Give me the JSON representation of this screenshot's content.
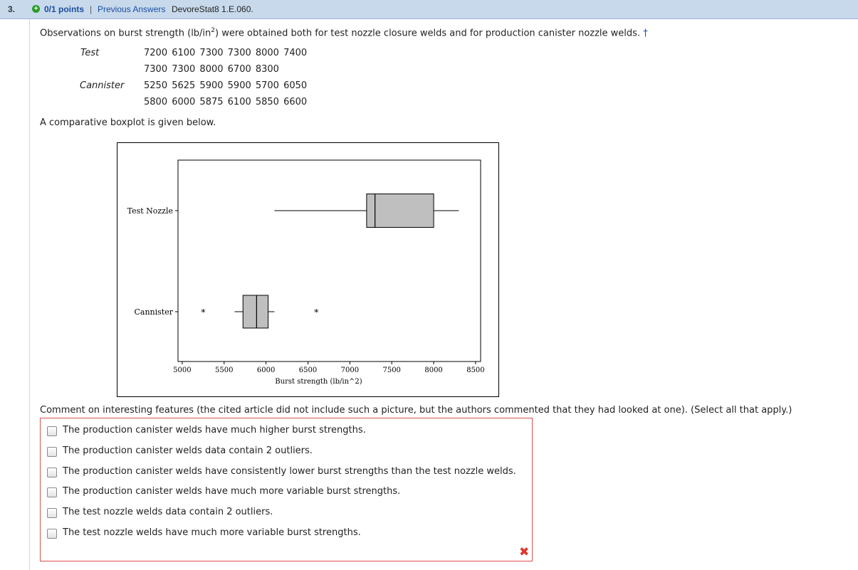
{
  "header": {
    "question_number": "3.",
    "plus_icon": "+",
    "points": "0/1 points",
    "separator": "|",
    "previous_answers": "Previous Answers",
    "code": "DevoreStat8 1.E.060."
  },
  "intro": {
    "before": "Observations on burst strength (lb/in",
    "sup": "2",
    "after": ") were obtained both for test nozzle closure welds and for production canister nozzle welds.",
    "dagger": "†"
  },
  "data_table": {
    "test_label": "Test",
    "test_row1": "7200 6100 7300 7300 8000 7400",
    "test_row2": "7300 7300 8000 6700 8300",
    "cannister_label": "Cannister",
    "cannister_row1": "5250 5625 5900 5900 5700 6050",
    "cannister_row2": "5800 6000 5875 6100 5850 6600"
  },
  "boxplot_intro": "A comparative boxplot is given below.",
  "chart_data": {
    "type": "boxplot",
    "xlabel": "Burst strength (lb/in^2)",
    "xlim": [
      4950,
      8560
    ],
    "xticks": [
      "5000",
      "5500",
      "6000",
      "6500",
      "7000",
      "7500",
      "8000",
      "8500"
    ],
    "xtick_values": [
      5000,
      5500,
      6000,
      6500,
      7000,
      7500,
      8000,
      8500
    ],
    "box_color": "#bfbfbf",
    "series": [
      {
        "name": "Test Nozzle",
        "whisker_low": 6100,
        "q1": 7200,
        "median": 7300,
        "q3": 8000,
        "whisker_high": 8300,
        "outliers": []
      },
      {
        "name": "Cannister",
        "whisker_low": 5625,
        "q1": 5725,
        "median": 5887.5,
        "q3": 6025,
        "whisker_high": 6100,
        "outliers": [
          5250,
          6600
        ]
      }
    ]
  },
  "question": "Comment on interesting features (the cited article did not include such a picture, but the authors commented that they had looked at one). (Select all that apply.)",
  "options": [
    "The production canister welds have much higher burst strengths.",
    "The production canister welds data contain 2 outliers.",
    "The production canister welds have consistently lower burst strengths than the test nozzle welds.",
    "The production canister welds have much more variable burst strengths.",
    "The test nozzle welds data contain 2 outliers.",
    "The test nozzle welds have much more variable burst strengths."
  ],
  "result_icon": "✖",
  "colors": {
    "header_bg": "#c8d9ec",
    "link": "#1a4fa0",
    "error": "#e0352b",
    "correct": "#2a9b2a"
  }
}
